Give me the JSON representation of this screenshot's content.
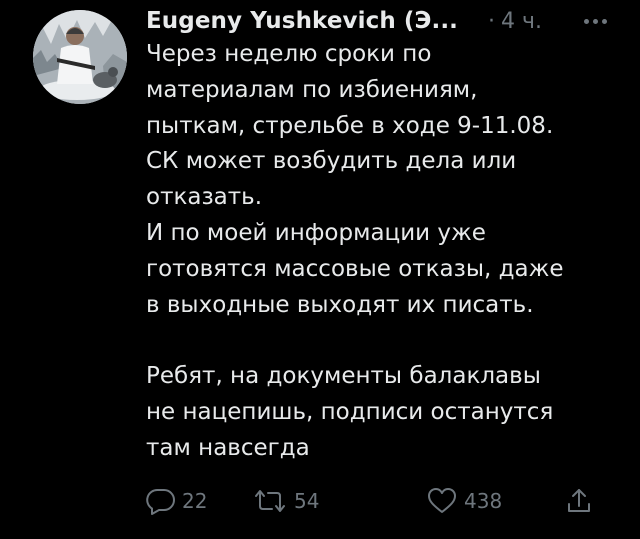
{
  "tweet": {
    "author": "Eugeny Yushkevich (Э...",
    "separator": "·",
    "time": "4 ч.",
    "text_lines": [
      "Через неделю сроки по",
      "материалам по избиениям,",
      "пыткам, стрельбе в ходе 9-11.08.",
      "СК может возбудить дела или",
      "отказать.",
      "И по моей информации уже",
      "готовятся массовые отказы, даже",
      "в выходные выходят их писать.",
      "",
      "Ребят, на документы балаклавы",
      "не нацепишь, подписи останутся",
      "там навсегда"
    ]
  },
  "actions": {
    "reply": {
      "icon": "reply-icon",
      "count": "22"
    },
    "retweet": {
      "icon": "retweet-icon",
      "count": "54"
    },
    "like": {
      "icon": "heart-icon",
      "count": "438"
    },
    "share": {
      "icon": "share-icon"
    }
  },
  "colors": {
    "background": "#000000",
    "text": "#e8eaeb",
    "muted": "#6e767d"
  }
}
